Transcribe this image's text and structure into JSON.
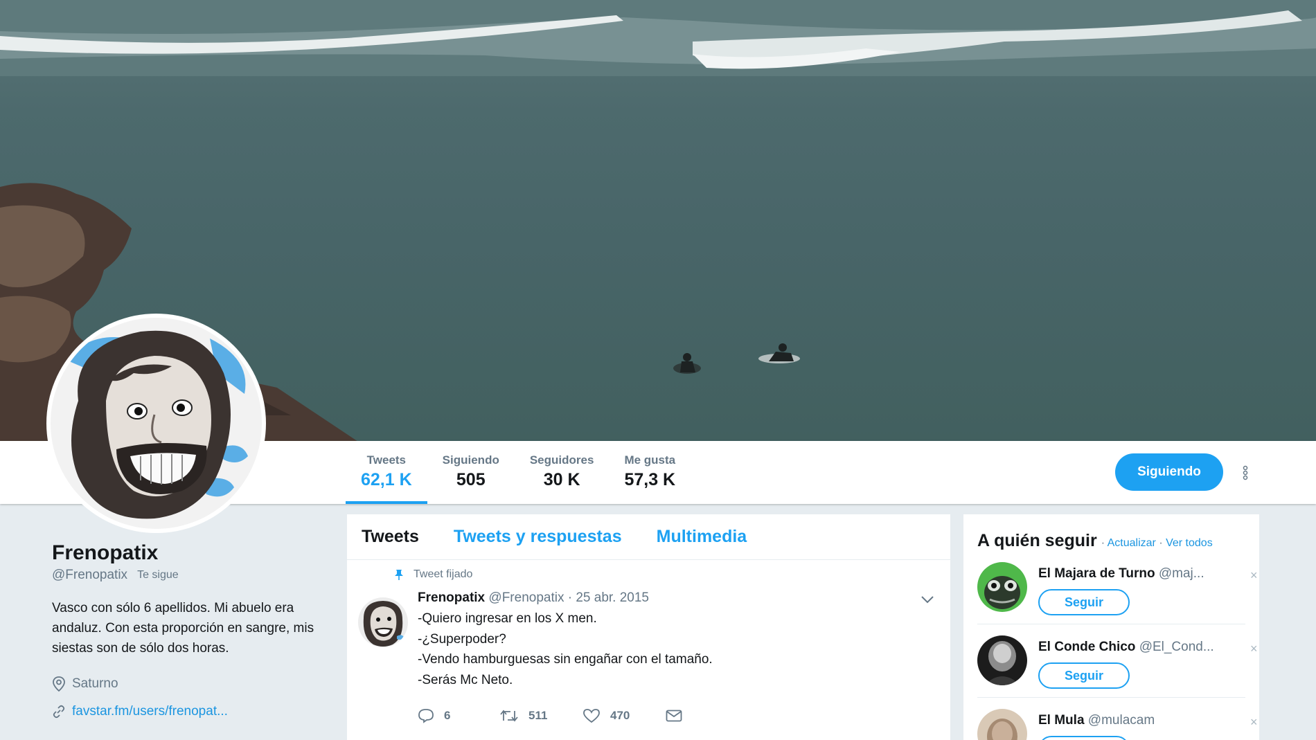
{
  "profile": {
    "full_name": "Frenopatix",
    "handle": "@Frenopatix",
    "follows_you": "Te sigue",
    "bio": "Vasco con sólo 6 apellidos. Mi abuelo era andaluz. Con esta proporción en sangre, mis siestas son de sólo dos horas.",
    "location": "Saturno",
    "url": "favstar.fm/users/frenopat..."
  },
  "nav": {
    "stats": [
      {
        "label": "Tweets",
        "value": "62,1 K",
        "active": true
      },
      {
        "label": "Siguiendo",
        "value": "505",
        "active": false
      },
      {
        "label": "Seguidores",
        "value": "30 K",
        "active": false
      },
      {
        "label": "Me gusta",
        "value": "57,3 K",
        "active": false
      }
    ],
    "following_button": "Siguiendo"
  },
  "timeline": {
    "tabs": [
      {
        "label": "Tweets",
        "active": true
      },
      {
        "label": "Tweets y respuestas",
        "active": false
      },
      {
        "label": "Multimedia",
        "active": false
      }
    ],
    "pinned_label": "Tweet fijado",
    "tweet": {
      "name": "Frenopatix",
      "meta": "@Frenopatix · 25 abr. 2015",
      "lines": [
        "-Quiero ingresar en los X men.",
        "-¿Superpoder?",
        "-Vendo hamburguesas sin engañar con el tamaño.",
        "-Serás Mc Neto."
      ],
      "replies": "6",
      "retweets": "511",
      "likes": "470"
    }
  },
  "who_to_follow": {
    "title": "A quién seguir",
    "separator": "·",
    "refresh": "Actualizar",
    "view_all": "Ver todos",
    "follow_label": "Seguir",
    "dismiss": "×",
    "users": [
      {
        "name": "El Majara de Turno",
        "handle": "@maj..."
      },
      {
        "name": "El Conde Chico",
        "handle": "@El_Cond..."
      },
      {
        "name": "El Mula",
        "handle": "@mulacam"
      }
    ]
  },
  "colors": {
    "accent": "#1da1f2",
    "link": "#1b95e0",
    "secondary_text": "#657786",
    "page_background": "#e6ecf0"
  },
  "icons": [
    "pin-icon",
    "location-icon",
    "link-icon",
    "reply-icon",
    "retweet-icon",
    "like-icon",
    "message-icon",
    "chevron-down-icon",
    "more-vertical-icon"
  ]
}
